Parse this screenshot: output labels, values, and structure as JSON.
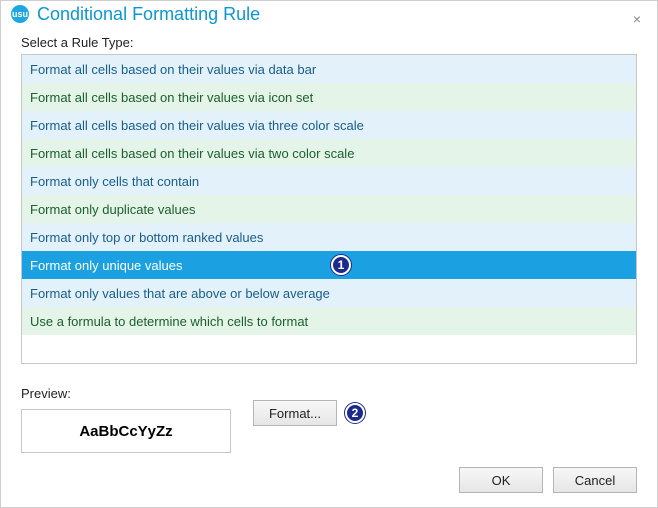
{
  "window": {
    "title": "Conditional Formatting Rule",
    "close_glyph": "×"
  },
  "labels": {
    "select_rule": "Select a Rule Type:",
    "preview": "Preview:"
  },
  "rules": {
    "items": [
      "Format all cells based on their values via data bar",
      "Format all cells based on their values via icon set",
      "Format all cells based on their values via three color scale",
      "Format all cells based on their values via two color scale",
      "Format only cells that contain",
      "Format only duplicate values",
      "Format only top or bottom ranked values",
      "Format only unique values",
      "Format only values that are above or below average",
      "Use a formula to determine which cells to format"
    ],
    "selected_index": 7
  },
  "annotations": {
    "balloon1": "1",
    "balloon2": "2"
  },
  "preview": {
    "sample_text": "AaBbCcYyZz"
  },
  "buttons": {
    "format": "Format...",
    "ok": "OK",
    "cancel": "Cancel"
  }
}
